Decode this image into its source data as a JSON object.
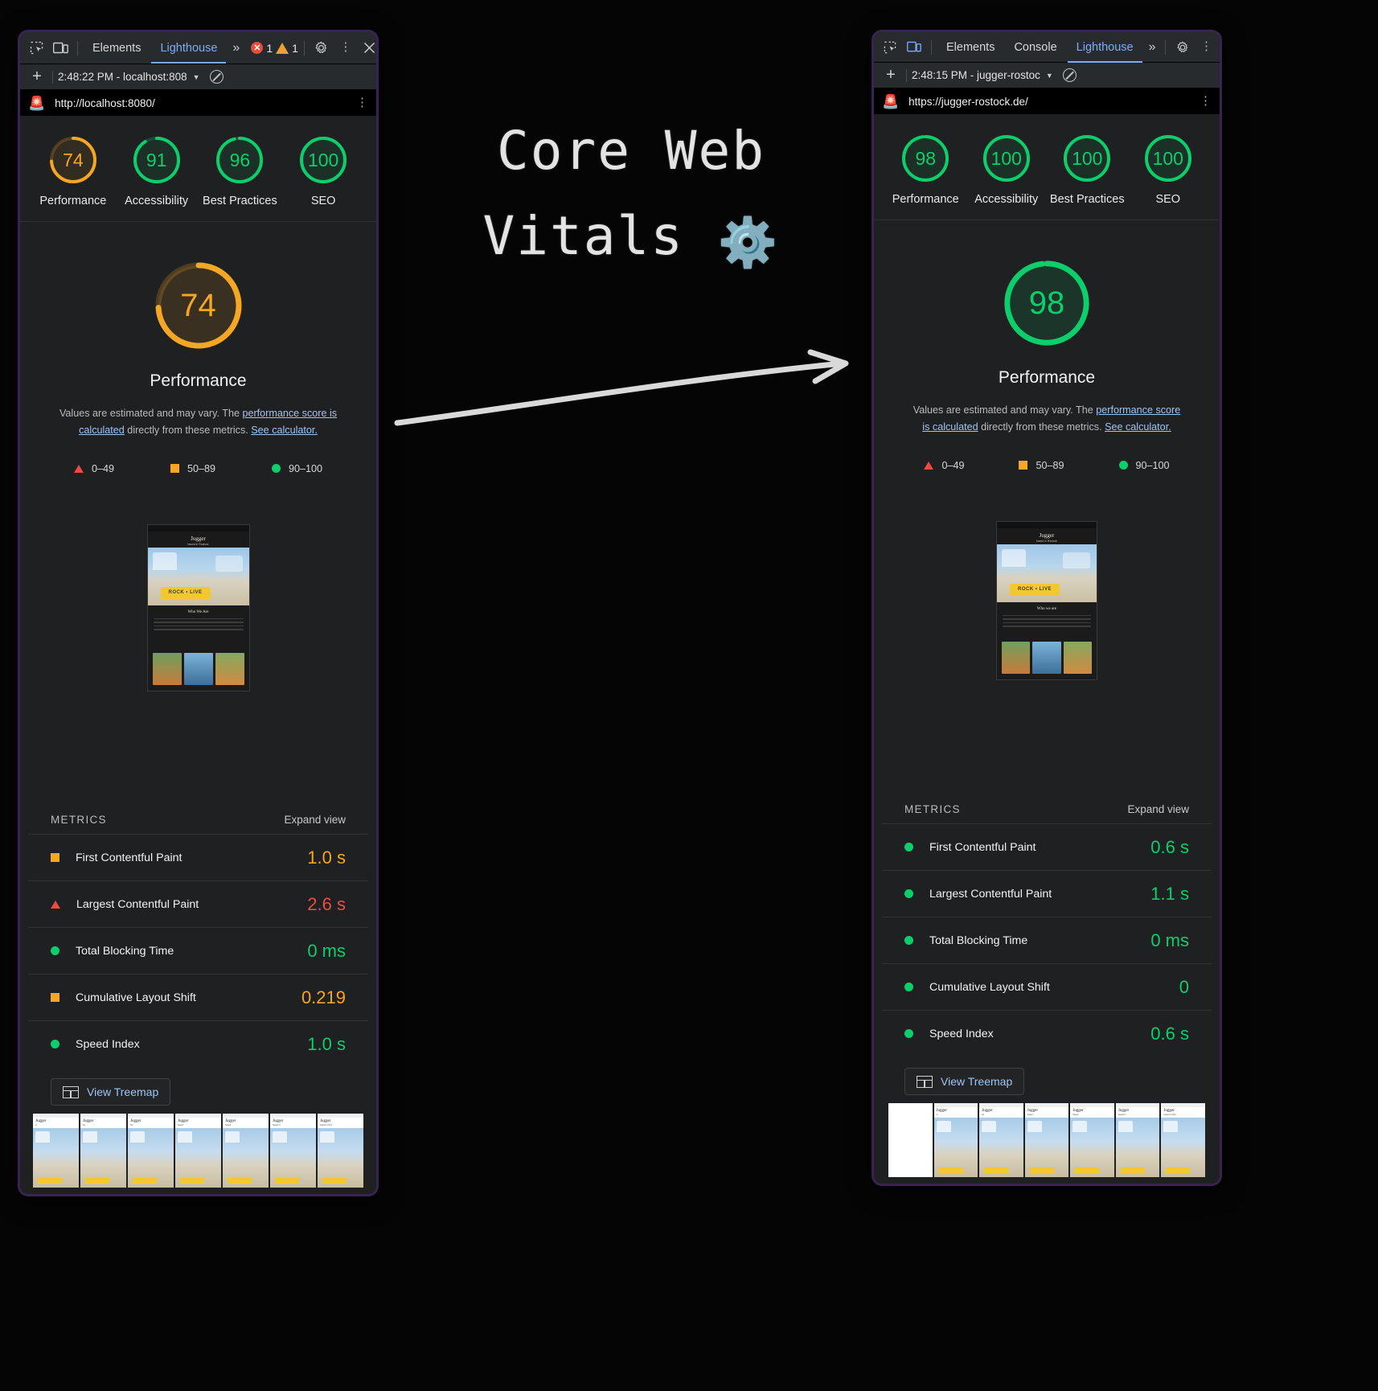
{
  "annotation": {
    "title_line1": "Core Web",
    "title_line2": "Vitals",
    "gear_icon": "gear-icon",
    "arrow": "arrow-right"
  },
  "left_panel": {
    "toolbar": {
      "inspect_icon": "inspect-element-icon",
      "device_icon": "device-toolbar-icon",
      "tabs": [
        {
          "label": "Elements",
          "active": false
        },
        {
          "label": "Lighthouse",
          "active": true
        }
      ],
      "more_tabs_icon": "chevron-double-right-icon",
      "error_count": "1",
      "warning_count": "1",
      "settings_icon": "gear-icon",
      "kebab_icon": "more-vertical-icon",
      "close_icon": "close-icon"
    },
    "runbar": {
      "add_label": "+",
      "run_selector": "2:48:22 PM - localhost:808",
      "caret_icon": "chevron-down-icon",
      "clear_icon": "no-entry-icon"
    },
    "urlbar": {
      "logo_icon": "lighthouse-icon",
      "url": "http://localhost:8080/",
      "kebab_icon": "more-vertical-icon"
    },
    "gauges": [
      {
        "score": 74,
        "label": "Performance",
        "color": "#f5a623"
      },
      {
        "score": 91,
        "label": "Accessibility",
        "color": "#0cce6b"
      },
      {
        "score": 96,
        "label": "Best Practices",
        "color": "#0cce6b"
      },
      {
        "score": 100,
        "label": "SEO",
        "color": "#0cce6b"
      }
    ],
    "big_gauge": {
      "score": 74,
      "title": "Performance",
      "color": "#f5a623",
      "track": "#4a3a18"
    },
    "description": {
      "part1": "Values are estimated and may vary. The ",
      "link1": "performance score is calculated",
      "part2": " directly from these metrics. ",
      "link2": "See calculator."
    },
    "legend": [
      {
        "shape": "triangle",
        "label": "0–49",
        "color": "#f04a3f"
      },
      {
        "shape": "square",
        "label": "50–89",
        "color": "#f5a623"
      },
      {
        "shape": "circle",
        "label": "90–100",
        "color": "#0cce6b"
      }
    ],
    "thumbnail": {
      "brand": "Jugger",
      "tagline": "based in Rostock",
      "banner_text": "ROCK • LIVE",
      "section_title": "Who We Are"
    },
    "metrics_header": {
      "title": "METRICS",
      "expand": "Expand view"
    },
    "metrics": [
      {
        "shape": "square",
        "label": "First Contentful Paint",
        "value": "1.0 s",
        "color": "#f5a623"
      },
      {
        "shape": "triangle",
        "label": "Largest Contentful Paint",
        "value": "2.6 s",
        "color": "#f04a3f"
      },
      {
        "shape": "circle",
        "label": "Total Blocking Time",
        "value": "0 ms",
        "color": "#0cce6b"
      },
      {
        "shape": "square",
        "label": "Cumulative Layout Shift",
        "value": "0.219",
        "color": "#f5a623"
      },
      {
        "shape": "circle",
        "label": "Speed Index",
        "value": "1.0 s",
        "color": "#0cce6b"
      }
    ],
    "treemap": {
      "label": "View Treemap",
      "icon": "treemap-icon"
    },
    "filmstrip_frames": 7,
    "filmstrip_blank_first": false
  },
  "right_panel": {
    "toolbar": {
      "inspect_icon": "inspect-element-icon",
      "device_icon": "device-toolbar-icon",
      "tabs": [
        {
          "label": "Elements",
          "active": false
        },
        {
          "label": "Console",
          "active": false
        },
        {
          "label": "Lighthouse",
          "active": true
        }
      ],
      "more_tabs_icon": "chevron-double-right-icon",
      "settings_icon": "gear-icon",
      "kebab_icon": "more-vertical-icon",
      "close_icon": "close-icon"
    },
    "runbar": {
      "add_label": "+",
      "run_selector": "2:48:15 PM - jugger-rostoc",
      "caret_icon": "chevron-down-icon",
      "clear_icon": "no-entry-icon"
    },
    "urlbar": {
      "logo_icon": "lighthouse-icon",
      "url": "https://jugger-rostock.de/",
      "kebab_icon": "more-vertical-icon"
    },
    "gauges": [
      {
        "score": 98,
        "label": "Performance",
        "color": "#0cce6b"
      },
      {
        "score": 100,
        "label": "Accessibility",
        "color": "#0cce6b"
      },
      {
        "score": 100,
        "label": "Best Practices",
        "color": "#0cce6b"
      },
      {
        "score": 100,
        "label": "SEO",
        "color": "#0cce6b"
      }
    ],
    "big_gauge": {
      "score": 98,
      "title": "Performance",
      "color": "#0cce6b",
      "track": "#124a2c"
    },
    "description": {
      "part1": "Values are estimated and may vary. The ",
      "link1": "performance score is calculated",
      "part2": " directly from these metrics. ",
      "link2": "See calculator."
    },
    "legend": [
      {
        "shape": "triangle",
        "label": "0–49",
        "color": "#f04a3f"
      },
      {
        "shape": "square",
        "label": "50–89",
        "color": "#f5a623"
      },
      {
        "shape": "circle",
        "label": "90–100",
        "color": "#0cce6b"
      }
    ],
    "thumbnail": {
      "brand": "Jugger",
      "tagline": "based in Rostock",
      "banner_text": "ROCK • LIVE",
      "section_title": "Who we are"
    },
    "metrics_header": {
      "title": "METRICS",
      "expand": "Expand view"
    },
    "metrics": [
      {
        "shape": "circle",
        "label": "First Contentful Paint",
        "value": "0.6 s",
        "color": "#0cce6b"
      },
      {
        "shape": "circle",
        "label": "Largest Contentful Paint",
        "value": "1.1 s",
        "color": "#0cce6b"
      },
      {
        "shape": "circle",
        "label": "Total Blocking Time",
        "value": "0 ms",
        "color": "#0cce6b"
      },
      {
        "shape": "circle",
        "label": "Cumulative Layout Shift",
        "value": "0",
        "color": "#0cce6b"
      },
      {
        "shape": "circle",
        "label": "Speed Index",
        "value": "0.6 s",
        "color": "#0cce6b"
      }
    ],
    "treemap": {
      "label": "View Treemap",
      "icon": "treemap-icon"
    },
    "filmstrip_frames": 7,
    "filmstrip_blank_first": true
  }
}
